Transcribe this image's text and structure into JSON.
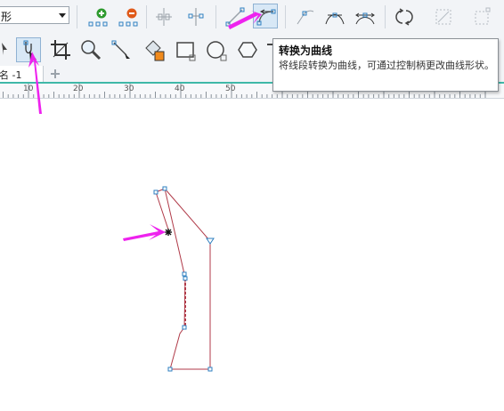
{
  "toolbar": {
    "shape_dropdown_value": "形",
    "icons": [
      "add-node-icon",
      "delete-node-icon",
      "join-nodes-icon",
      "break-curve-icon",
      "to-line-icon",
      "to-curve-icon",
      "cusp-node-icon",
      "smooth-node-icon",
      "symmetric-node-icon",
      "reverse-direction-icon",
      "extract-subpath-icon",
      "elastic-mode-icon"
    ]
  },
  "toolbox": {
    "icons": [
      "shape-tool-icon",
      "crop-tool-icon",
      "zoom-tool-icon",
      "freehand-tool-icon",
      "smart-fill-icon",
      "rectangle-tool-icon",
      "ellipse-tool-icon",
      "polygon-tool-icon"
    ]
  },
  "document_tab": {
    "label": "命名 -1"
  },
  "ruler": {
    "labels": [
      "10",
      "20",
      "30",
      "40",
      "50",
      "60",
      "70",
      "80",
      "90",
      "100"
    ]
  },
  "tooltip": {
    "title": "转换为曲线",
    "description": "将线段转换为曲线，可通过控制柄更改曲线形状。"
  },
  "colors": {
    "accent_arrow": "#ee22ee",
    "path_stroke": "#b03a48",
    "node_color": "#2e7fc0",
    "tab_underline": "#3fb8a8"
  }
}
